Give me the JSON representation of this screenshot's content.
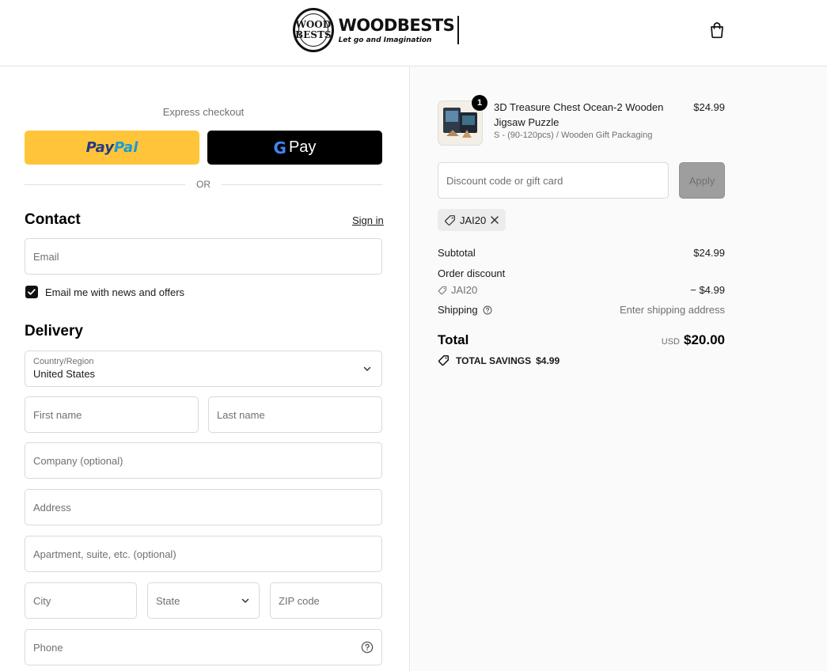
{
  "header": {
    "brand_badge_top": "WOOD",
    "brand_badge_bottom": "BESTS",
    "brand_name": "WOODBESTS",
    "brand_tagline": "Let go and Imagination",
    "cart_icon": "shopping-bag-icon"
  },
  "express": {
    "label": "Express checkout",
    "paypal_part1": "Pay",
    "paypal_part2": "Pal",
    "gpay_label": "Pay",
    "or_label": "OR"
  },
  "contact": {
    "title": "Contact",
    "signin_label": "Sign in",
    "email_placeholder": "Email",
    "newsletter_label": "Email me with news and offers",
    "newsletter_checked": true
  },
  "delivery": {
    "title": "Delivery",
    "country_label": "Country/Region",
    "country_value": "United States",
    "first_name_placeholder": "First name",
    "last_name_placeholder": "Last name",
    "company_placeholder": "Company (optional)",
    "address_placeholder": "Address",
    "apartment_placeholder": "Apartment, suite, etc. (optional)",
    "city_placeholder": "City",
    "state_placeholder": "State",
    "zip_placeholder": "ZIP code",
    "phone_placeholder": "Phone"
  },
  "summary": {
    "product": {
      "quantity": "1",
      "name": "3D Treasure Chest Ocean-2 Wooden Jigsaw Puzzle",
      "variant": "S - (90-120pcs) / Wooden Gift Packaging",
      "price": "$24.99"
    },
    "discount_placeholder": "Discount code or gift card",
    "apply_label": "Apply",
    "applied_code": "JAI20",
    "subtotal_label": "Subtotal",
    "subtotal_value": "$24.99",
    "order_discount_label": "Order discount",
    "discount_code": "JAI20",
    "discount_value": "− $4.99",
    "shipping_label": "Shipping",
    "shipping_value": "Enter shipping address",
    "total_label": "Total",
    "currency": "USD",
    "total_value": "$20.00",
    "savings_label": "TOTAL SAVINGS",
    "savings_value": "$4.99"
  },
  "colors": {
    "paypal_yellow": "#ffc439",
    "paypal_dark_blue": "#253b80",
    "paypal_light_blue": "#179bd7",
    "gpay_black": "#000000",
    "apply_disabled": "#9e9e9e",
    "summary_bg": "#fafafa"
  }
}
